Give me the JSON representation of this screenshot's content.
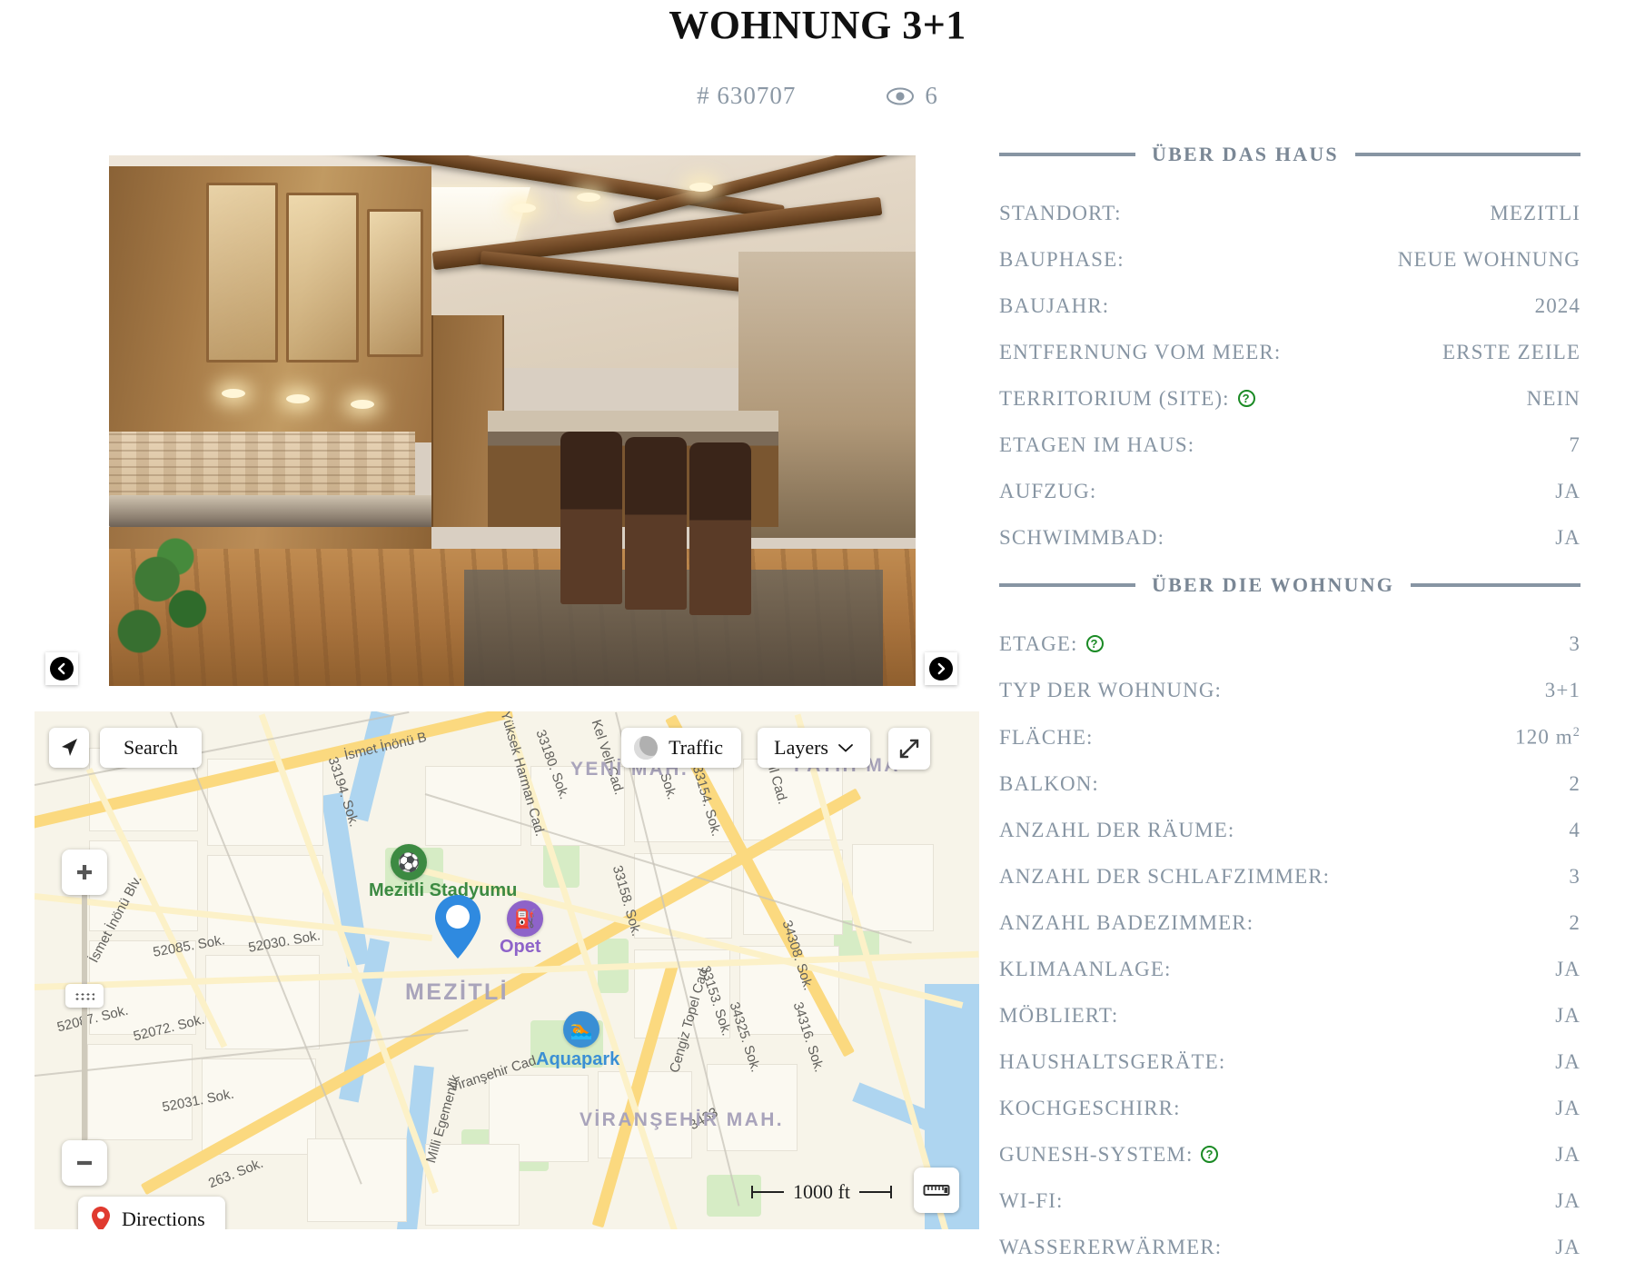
{
  "header": {
    "title": "WOHNUNG 3+1",
    "listing_id": "# 630707",
    "views": "6",
    "eye_icon": "eye-icon"
  },
  "gallery": {
    "prev_label": "previous-photo",
    "next_label": "next-photo",
    "photo_alt": "kitchen-interior-wood-cabinets"
  },
  "map": {
    "locate_icon": "navigation-arrow-icon",
    "search_label": "Search",
    "traffic_label": "Traffic",
    "layers_label": "Layers",
    "expand_icon": "fullscreen-expand-icon",
    "zoom_in_label": "+",
    "zoom_out_label": "−",
    "scale_label": "1000 ft",
    "ruler_icon": "ruler-icon",
    "directions_label": "Directions",
    "pin_icon": "location-pin-icon",
    "labels": {
      "area_primary": "MEZİTLİ",
      "area_secondary": "YENİ MAH.",
      "area_third": "VİRANŞEHİR MAH.",
      "area_fourth": "FATİH MA",
      "poi_stadium": "Mezitli Stadyumu",
      "poi_gas": "Opet",
      "poi_aquapark": "Aquapark",
      "streets": [
        "İsmet İnönü B",
        "İsmet İnönü Blv.",
        "Kel Veli Cad.",
        "Yüksek Harman Cad.",
        "33180. Sok.",
        "33194. Sok.",
        "33171. Sok.",
        "33154. Sok.",
        "33153. Sok.",
        "33158. Sok.",
        "Babil Cad.",
        "52085. Sok.",
        "52030. Sok.",
        "52087. Sok.",
        "52072. Sok.",
        "52031. Sok.",
        "34308. Sok.",
        "34325. Sok.",
        "34316. Sok.",
        "Cengiz Topel Cad.",
        "Viranşehir Cad.",
        "Milli Egemenlik",
        "263. Sok.",
        "3433"
      ]
    }
  },
  "details": {
    "house_section": {
      "title": "ÜBER DAS HAUS",
      "rows": [
        {
          "label": "STANDORT:",
          "value": "MEZITLI",
          "help": false
        },
        {
          "label": "BAUPHASE:",
          "value": "NEUE WOHNUNG",
          "help": false
        },
        {
          "label": "BAUJAHR:",
          "value": "2024",
          "help": false
        },
        {
          "label": "ENTFERNUNG VOM MEER:",
          "value": "ERSTE ZEILE",
          "help": false
        },
        {
          "label": "TERRITORIUM (SITE):",
          "value": "NEIN",
          "help": true
        },
        {
          "label": "ETAGEN IM HAUS:",
          "value": "7",
          "help": false
        },
        {
          "label": "AUFZUG:",
          "value": "JA",
          "help": false
        },
        {
          "label": "SCHWIMMBAD:",
          "value": "JA",
          "help": false
        }
      ]
    },
    "apartment_section": {
      "title": "ÜBER DIE WOHNUNG",
      "rows": [
        {
          "label": "ETAGE:",
          "value": "3",
          "help": true
        },
        {
          "label": "TYP DER WOHNUNG:",
          "value": "3+1",
          "help": false
        },
        {
          "label": "FLÄCHE:",
          "value": "120 m",
          "help": false,
          "sup": "2"
        },
        {
          "label": "BALKON:",
          "value": "2",
          "help": false
        },
        {
          "label": "ANZAHL DER RÄUME:",
          "value": "4",
          "help": false
        },
        {
          "label": "ANZAHL DER SCHLAFZIMMER:",
          "value": "3",
          "help": false
        },
        {
          "label": "ANZAHL BADEZIMMER:",
          "value": "2",
          "help": false
        },
        {
          "label": "KLIMAANLAGE:",
          "value": "JA",
          "help": false
        },
        {
          "label": "MÖBLIERT:",
          "value": "JA",
          "help": false
        },
        {
          "label": "HAUSHALTSGERÄTE:",
          "value": "JA",
          "help": false
        },
        {
          "label": "KOCHGESCHIRR:",
          "value": "JA",
          "help": false
        },
        {
          "label": "GUNESH-SYSTEM:",
          "value": "JA",
          "help": true
        },
        {
          "label": "WI-FI:",
          "value": "JA",
          "help": false
        },
        {
          "label": "WASSERERWÄRMER:",
          "value": "JA",
          "help": false
        }
      ]
    }
  },
  "colors": {
    "text_muted": "#8795a3",
    "title": "#111111",
    "help_green": "#1a8a24",
    "road_major": "#fbd97f",
    "water": "#aed5f0",
    "marker_blue": "#2f8ae0"
  }
}
